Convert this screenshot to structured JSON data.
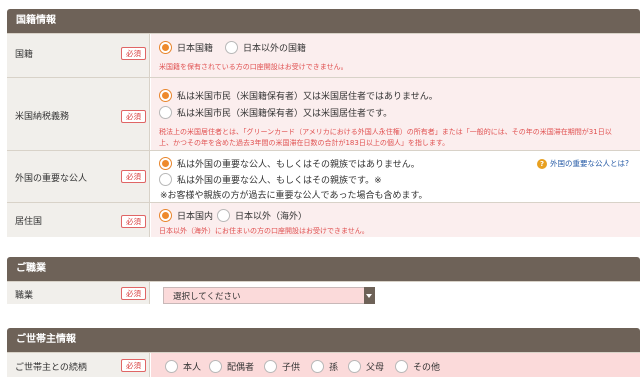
{
  "nationality": {
    "title": "国籍情報",
    "rows": {
      "nationality": {
        "label": "国籍",
        "required": "必須",
        "options": [
          "日本国籍",
          "日本以外の国籍"
        ],
        "error": "米国籍を保有されている方の口座開設はお受けできません。"
      },
      "us_tax": {
        "label": "米国納税義務",
        "required": "必須",
        "options": [
          "私は米国市民（米国籍保有者）又は米国居住者ではありません。",
          "私は米国市民（米国籍保有者）又は米国居住者です。"
        ],
        "error_line1": "税法上の米国居住者とは、「グリーンカード（アメリカにおける外国人永住権）の所有者」または「一般的には、その年の米国滞在期間が31日以",
        "error_line2": "上、かつその年を含めた過去3年間の米国滞在日数の合計が183日以上の個人」を指します。"
      },
      "pep": {
        "label": "外国の重要な公人",
        "required": "必須",
        "options": [
          "私は外国の重要な公人、もしくはその親族ではありません。",
          "私は外国の重要な公人、もしくはその親族です。※"
        ],
        "note": "※お客様や親族の方が過去に重要な公人であった場合も含めます。",
        "help_link": "外国の重要な公人とは?"
      },
      "residence": {
        "label": "居住国",
        "required": "必須",
        "options": [
          "日本国内",
          "日本以外（海外）"
        ],
        "error": "日本以外（海外）にお住まいの方の口座開設はお受けできません。"
      }
    }
  },
  "occupation": {
    "title": "ご職業",
    "label": "職業",
    "required": "必須",
    "select_value": "選択してください"
  },
  "household": {
    "title": "ご世帯主情報",
    "label": "ご世帯主との続柄",
    "required": "必須",
    "options": [
      "本人",
      "配偶者",
      "子供",
      "孫",
      "父母",
      "その他"
    ]
  },
  "colors": {
    "header_bg": "#6e6258",
    "accent_orange": "#ee8a2c",
    "error_red": "#e05050",
    "link_blue": "#2a5ea8"
  }
}
